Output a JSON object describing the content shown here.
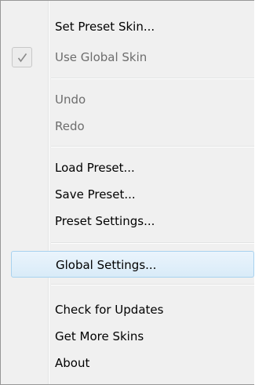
{
  "menu": {
    "items": [
      {
        "label": "Set Preset Skin...",
        "enabled": true
      },
      {
        "label": "Use Global Skin",
        "enabled": false,
        "checked": true
      },
      {
        "label": "Undo",
        "enabled": false
      },
      {
        "label": "Redo",
        "enabled": false
      },
      {
        "label": "Load Preset...",
        "enabled": true
      },
      {
        "label": "Save Preset...",
        "enabled": true
      },
      {
        "label": "Preset Settings...",
        "enabled": true
      },
      {
        "label": "Global Settings...",
        "enabled": true,
        "highlighted": true
      },
      {
        "label": "Check for Updates",
        "enabled": true
      },
      {
        "label": "Get More Skins",
        "enabled": true
      },
      {
        "label": "About",
        "enabled": true
      }
    ]
  },
  "colors": {
    "menu_bg": "#f0f0f0",
    "disabled_text": "#6d6d6d",
    "highlight_border": "#a8d2ef"
  },
  "icons": {
    "check": "checkmark-icon"
  }
}
